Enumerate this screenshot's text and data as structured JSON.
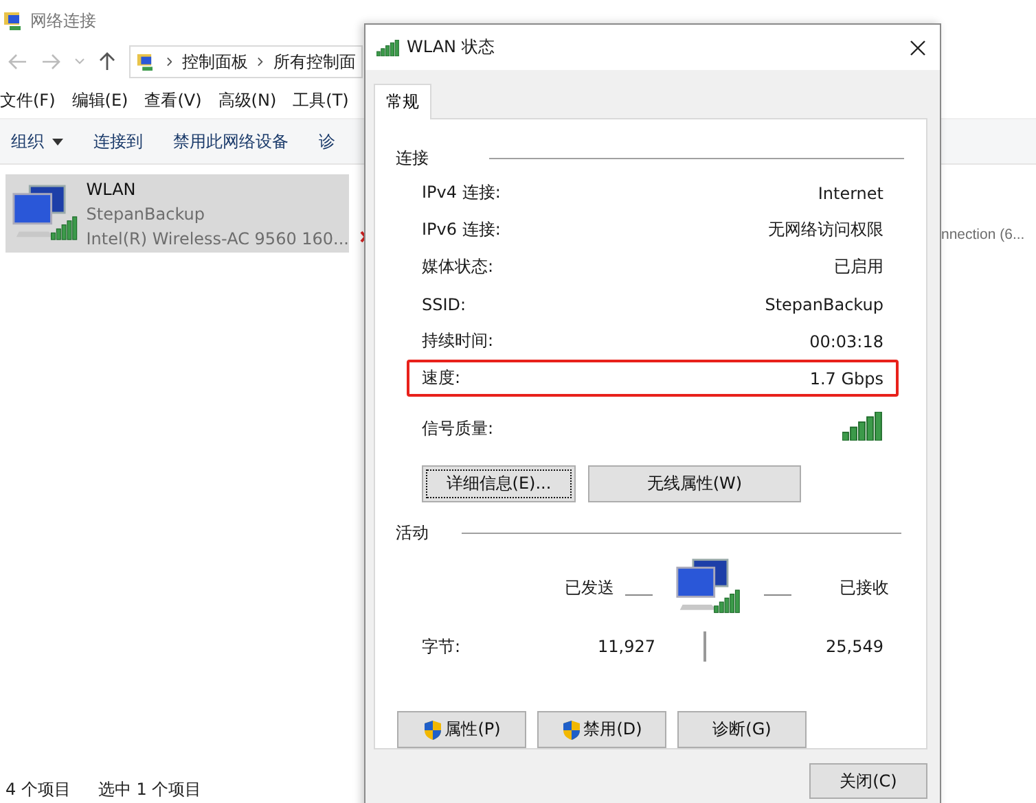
{
  "explorer": {
    "title": "网络连接",
    "address": [
      "控制面板",
      "所有控制面"
    ],
    "menu": [
      "文件(F)",
      "编辑(E)",
      "查看(V)",
      "高级(N)",
      "工具(T)"
    ],
    "toolbar": [
      {
        "label": "组织",
        "dropdown": true
      },
      {
        "label": "连接到",
        "dropdown": false
      },
      {
        "label": "禁用此网络设备",
        "dropdown": false
      },
      {
        "label": "诊",
        "dropdown": false
      }
    ],
    "connections": [
      {
        "name": "WLAN",
        "network": "StepanBackup",
        "adapter": "Intel(R) Wireless-AC 9560 160...",
        "selected": true
      }
    ],
    "partial_item": "nnection (6...",
    "status_bar": [
      "4 个项目",
      "选中 1 个项目"
    ]
  },
  "dialog": {
    "title": "WLAN 状态",
    "tabs": [
      {
        "label": "常规",
        "selected": true
      }
    ],
    "connection_heading": "连接",
    "rows": [
      {
        "label": "IPv4 连接:",
        "value": "Internet",
        "highlighted": false
      },
      {
        "label": "IPv6 连接:",
        "value": "无网络访问权限",
        "highlighted": false
      },
      {
        "label": "媒体状态:",
        "value": "已启用",
        "highlighted": false
      },
      {
        "label": "SSID:",
        "value": "StepanBackup",
        "highlighted": false
      },
      {
        "label": "持续时间:",
        "value": "00:03:18",
        "highlighted": false
      },
      {
        "label": "速度:",
        "value": "1.7 Gbps",
        "highlighted": true
      }
    ],
    "signal_label": "信号质量:",
    "detail_buttons": [
      {
        "label": "详细信息(E)...",
        "focused": true
      },
      {
        "label": "无线属性(W)",
        "focused": false
      }
    ],
    "activity_heading": "活动",
    "sent_label": "已发送",
    "received_label": "已接收",
    "bytes": {
      "label": "字节:",
      "sent": "11,927",
      "received": "25,549"
    },
    "action_buttons": [
      {
        "label": "属性(P)",
        "shield": true
      },
      {
        "label": "禁用(D)",
        "shield": true
      },
      {
        "label": "诊断(G)",
        "shield": false
      }
    ],
    "close_button": "关闭(C)"
  }
}
